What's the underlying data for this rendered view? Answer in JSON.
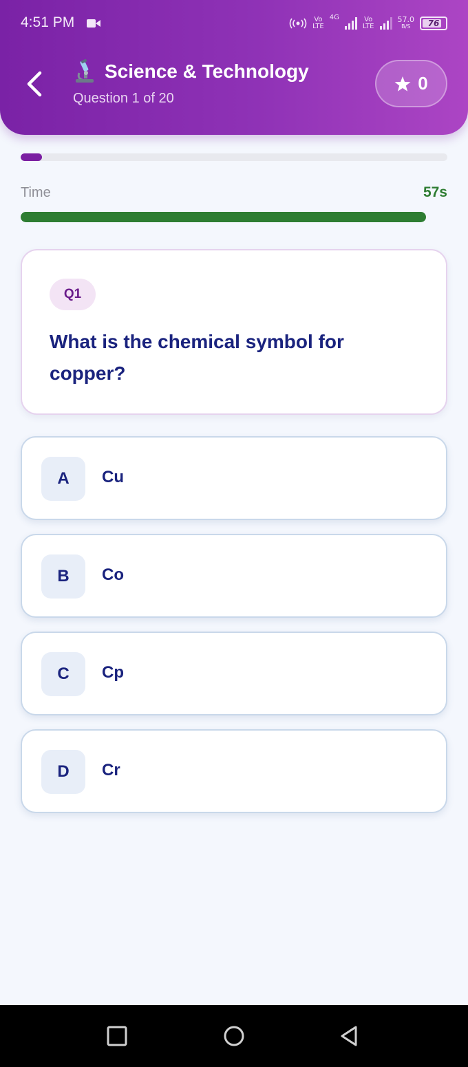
{
  "status_bar": {
    "time": "4:51 PM",
    "signal1_top": "Vo",
    "signal1_bottom": "LTE",
    "net_type": "4G",
    "signal2_top": "Vo",
    "signal2_bottom": "LTE",
    "speed_value": "57.0",
    "speed_unit": "B/S",
    "battery": "76",
    "battery_level": 0.76
  },
  "header": {
    "category_icon": "microscope-icon",
    "title": "Science & Technology",
    "subtitle": "Question 1 of 20",
    "score": "0"
  },
  "progress": {
    "current": 1,
    "total": 20
  },
  "timer": {
    "label": "Time",
    "value": "57s",
    "remaining_fraction": 0.95
  },
  "question": {
    "badge": "Q1",
    "text": "What is the chemical symbol for copper?"
  },
  "options": [
    {
      "letter": "A",
      "text": "Cu"
    },
    {
      "letter": "B",
      "text": "Co"
    },
    {
      "letter": "C",
      "text": "Cp"
    },
    {
      "letter": "D",
      "text": "Cr"
    }
  ],
  "colors": {
    "header_start": "#7a22a6",
    "header_end": "#ac45c4",
    "progress": "#7b1fa2",
    "timer": "#2e7d32",
    "question_text": "#1a237e"
  },
  "nav": {
    "recent": "square-icon",
    "home": "circle-icon",
    "back": "triangle-back-icon"
  }
}
